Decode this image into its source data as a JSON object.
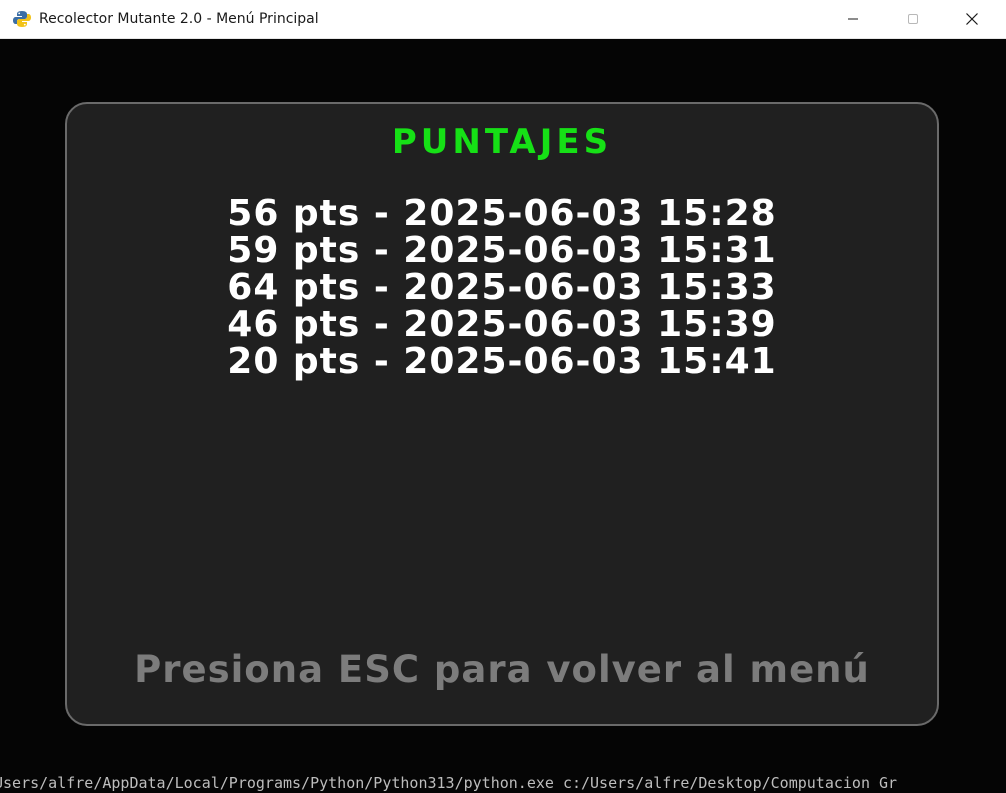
{
  "window": {
    "title": "Recolector Mutante 2.0 - Menú Principal",
    "app_icon": "python-snake-icon",
    "controls": {
      "minimize_icon": "minimize-icon",
      "maximize_icon": "maximize-icon",
      "close_icon": "close-icon"
    }
  },
  "scores_screen": {
    "title": "PUNTAJES",
    "title_color": "#16e016",
    "entries": [
      "56 pts - 2025-06-03 15:28",
      "59 pts - 2025-06-03 15:31",
      "64 pts - 2025-06-03 15:33",
      "46 pts - 2025-06-03 15:39",
      "20 pts - 2025-06-03 15:41"
    ],
    "hint": "Presiona ESC para volver al menú",
    "hint_color": "#7c7c7c"
  },
  "background_terminal": {
    "text": "Users/alfre/AppData/Local/Programs/Python/Python313/python.exe c:/Users/alfre/Desktop/Computacion Gr"
  }
}
